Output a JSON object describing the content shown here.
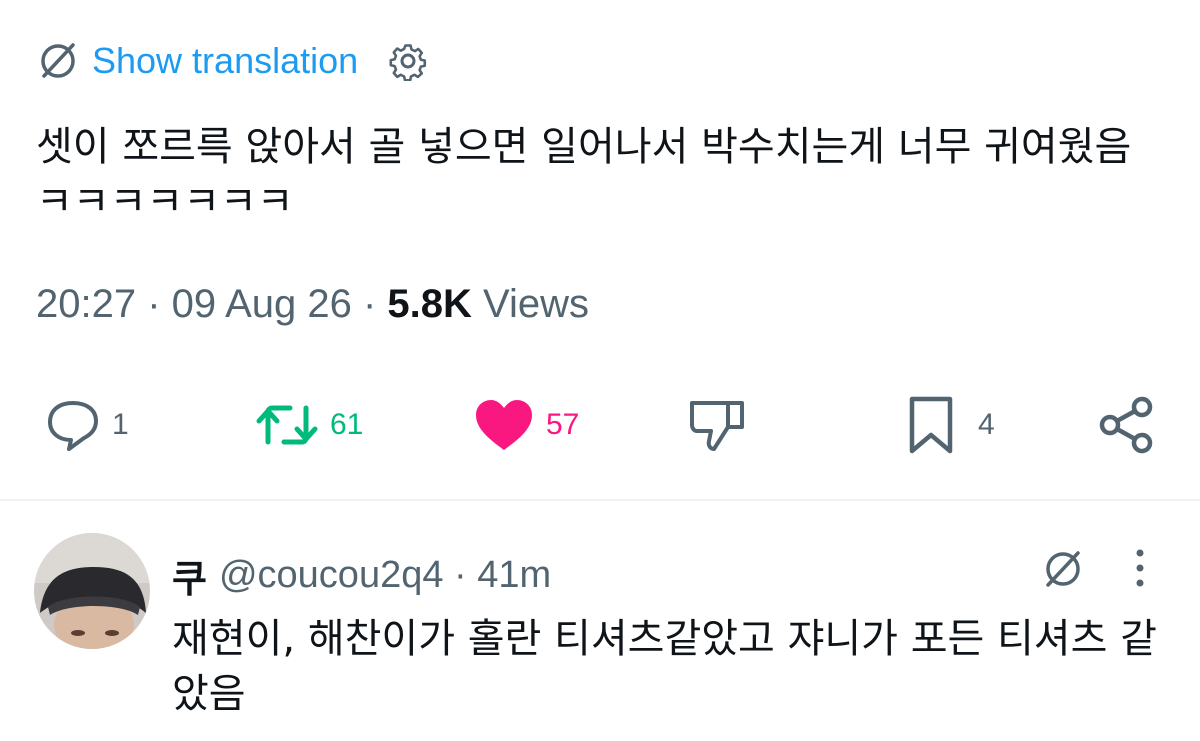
{
  "post": {
    "show_translation": "Show translation",
    "text": "셋이 쪼르륵 앉아서 골 넣으면 일어나서 박수치는게 너무 귀여웠음 ㅋㅋㅋㅋㅋㅋㅋ",
    "time": "20:27",
    "date": "09 Aug 26",
    "views_count": "5.8K",
    "views_label": "Views"
  },
  "actions": {
    "replies": "1",
    "reposts": "61",
    "likes": "57",
    "bookmarks": "4"
  },
  "reply": {
    "name": "쿠",
    "handle": "@coucou2q4",
    "age": "41m",
    "text": "재현이, 해찬이가 홀란 티셔츠같았고 쟈니가 포든 티셔츠 같았음"
  },
  "colors": {
    "link": "#1d9bf0",
    "secondary_text": "#536471",
    "repost": "#00ba7c",
    "like": "#f91880",
    "icon": "#536471"
  },
  "icons": {
    "translate": "globe-slash-icon",
    "settings": "gear-icon",
    "reply": "speech-bubble-icon",
    "repost": "repost-arrows-icon",
    "like": "heart-filled-icon",
    "dislike": "thumbs-down-icon",
    "bookmark": "bookmark-icon",
    "share": "share-icon",
    "more": "kebab-icon"
  }
}
